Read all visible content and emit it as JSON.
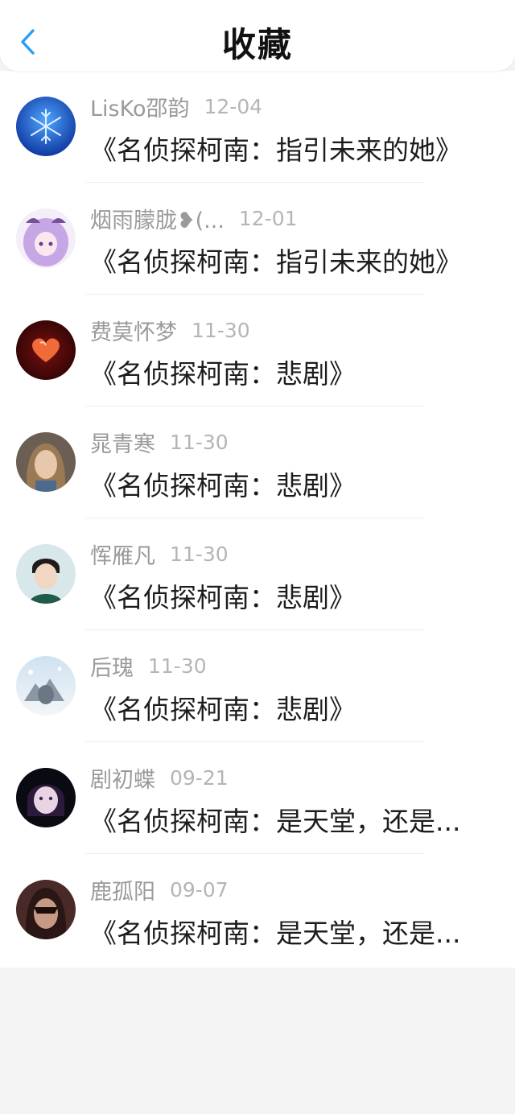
{
  "header": {
    "title": "收藏",
    "back_icon": "chevron-left-icon",
    "accent_color": "#2a9df4"
  },
  "items": [
    {
      "name": "LisKo邵韵",
      "date": "12-04",
      "text": "《名侦探柯南：指引未来的她》",
      "avatar": "snowflake-avatar"
    },
    {
      "name": "烟雨朦胧❥(...",
      "date": "12-01",
      "text": "《名侦探柯南：指引未来的她》",
      "avatar": "anime-girl-avatar"
    },
    {
      "name": "费莫怀梦",
      "date": "11-30",
      "text": "《名侦探柯南：悲剧》",
      "avatar": "heart-avatar"
    },
    {
      "name": "晁青寒",
      "date": "11-30",
      "text": "《名侦探柯南：悲剧》",
      "avatar": "woman-portrait-avatar"
    },
    {
      "name": "恽雁凡",
      "date": "11-30",
      "text": "《名侦探柯南：悲剧》",
      "avatar": "boy-portrait-avatar"
    },
    {
      "name": "后瑰",
      "date": "11-30",
      "text": "《名侦探柯南：悲剧》",
      "avatar": "winter-scene-avatar"
    },
    {
      "name": "剧初蝶",
      "date": "09-21",
      "text": "《名侦探柯南：是天堂，还是...",
      "avatar": "girl-face-avatar"
    },
    {
      "name": "鹿孤阳",
      "date": "09-07",
      "text": "《名侦探柯南：是天堂，还是...",
      "avatar": "masked-face-avatar"
    }
  ]
}
